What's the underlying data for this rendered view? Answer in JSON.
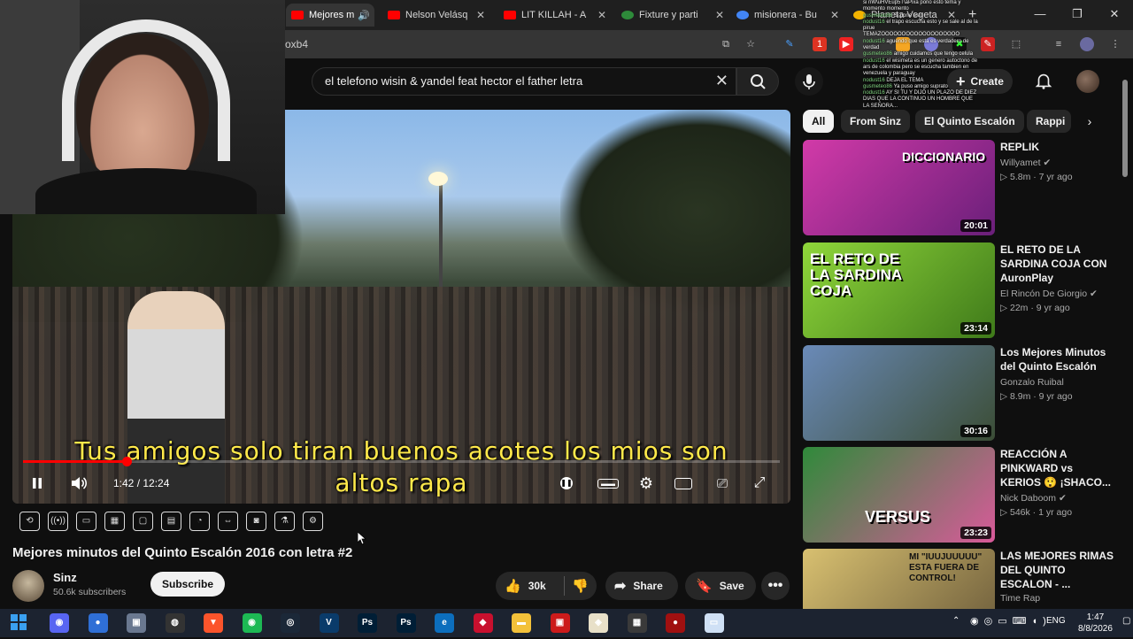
{
  "browser": {
    "tabs": [
      {
        "label": "Mejores m",
        "favicon_color": "#ff0000",
        "active": true
      },
      {
        "label": "Nelson Velásq",
        "favicon_color": "#ff0000",
        "active": false
      },
      {
        "label": "LIT KILLAH - A",
        "favicon_color": "#ff0000",
        "active": false
      },
      {
        "label": "Fixture y parti",
        "favicon_color": "#2e8b3a",
        "active": false
      },
      {
        "label": "misionera - Bu",
        "favicon_color": "#4285f4",
        "active": false
      },
      {
        "label": "Planeta Vegeta",
        "favicon_color": "#f4b400",
        "active": false
      }
    ],
    "new_tab": "+",
    "url_fragment": "oxb4",
    "extension_badge": "1"
  },
  "youtube": {
    "search_query": "el telefono wisin & yandel feat hector el father letra",
    "create_label": "Create"
  },
  "chat_overlay": [
    {
      "user": "",
      "msg": "si nW\\uHVEup5T\\aPixa  pono esto tema y"
    },
    {
      "user": "",
      "msg": "momento momento"
    },
    {
      "user": "gusmeteo86",
      "msg": "Si pone esto"
    },
    {
      "user": "nodust16",
      "msg": "el trapo escucha esto y se sale al de la pirue"
    },
    {
      "user": "",
      "msg": "TEMAZOOOOOOOOOOOOOOOOOOO"
    },
    {
      "user": "nodust16",
      "msg": "aguendo que esta es verdadero de verdad"
    },
    {
      "user": "gusmeteo86",
      "msg": "amigo cuidamos que tengo celula"
    },
    {
      "user": "nodust16",
      "msg": "el wisimeta es un genero autoctono de ars de colombia pero se escucha tambien en venezuela y paraguay"
    },
    {
      "user": "nodust16",
      "msg": "DEJA EL TEMA"
    },
    {
      "user": "gusmeteo86",
      "msg": "Ya puso amigo suprato"
    },
    {
      "user": "nodust16",
      "msg": "AY SI TU Y DIJO UN PLAZO DE DIEZ DIAS QUE LA CONTINUO UN HOMBRE QUE LA SEÑORA..."
    }
  ],
  "player": {
    "subtitle_line1": "Tus amigos solo tiran buenos acotes los mios son",
    "subtitle_line2": "altos rapa",
    "time": "1:42 / 12:24",
    "progress": 0.137
  },
  "video": {
    "title": "Mejores minutos del Quinto Escalón 2016 con letra #2",
    "channel": "Sinz",
    "subscribers": "50.6k subscribers",
    "subscribe_label": "Subscribe",
    "likes": "30k",
    "share_label": "Share",
    "save_label": "Save"
  },
  "chips": [
    "All",
    "From Sinz",
    "El Quinto Escalón",
    "Rappi"
  ],
  "recommendations": [
    {
      "title": "REPLIK",
      "channel": "Willyamet",
      "meta": "5.8m · 7 yr ago",
      "duration": "20:01",
      "thumb_text": "DICCIONARIO",
      "colors": [
        "#d23aa8",
        "#6a1f7a"
      ]
    },
    {
      "title": "EL RETO DE LA SARDINA COJA CON AuronPlay",
      "channel": "El Rincón De Giorgio",
      "meta": "22m · 9 yr ago",
      "duration": "23:14",
      "thumb_text": "EL RETO DE LA SARDINA COJA",
      "colors": [
        "#8fd63a",
        "#3f7a1a"
      ]
    },
    {
      "title": "Los Mejores Minutos del Quinto Escalón",
      "channel": "Gonzalo Ruibal",
      "meta": "8.9m · 9 yr ago",
      "duration": "30:16",
      "thumb_text": "",
      "colors": [
        "#6a8ab8",
        "#3b4d35"
      ]
    },
    {
      "title": "REACCIÓN A PINKWARD vs KERIOS 😲 ¡SHACO...",
      "channel": "Nick Daboom",
      "meta": "546k · 1 yr ago",
      "duration": "23:23",
      "thumb_text": "VERSUS",
      "colors": [
        "#2f8a3a",
        "#d95a9a"
      ]
    },
    {
      "title": "LAS MEJORES RIMAS DEL QUINTO ESCALON - ...",
      "channel": "Time Rap",
      "meta": "",
      "duration": "",
      "thumb_text": "MI \"IUUJUUUUU\" ESTA FUERA DE CONTROL!",
      "colors": [
        "#d8c070",
        "#6a5a3a"
      ]
    }
  ],
  "taskbar": {
    "tray_lang": "ENG",
    "clock_time": "1:47",
    "clock_date": "8/8/2026",
    "apps": [
      {
        "name": "discord-icon",
        "color": "#5865f2",
        "glyph": "◉"
      },
      {
        "name": "chrome-icon",
        "color": "#2f6fd6",
        "glyph": "●"
      },
      {
        "name": "app-icon",
        "color": "#6a7890",
        "glyph": "▣"
      },
      {
        "name": "obs-icon",
        "color": "#333333",
        "glyph": "◍"
      },
      {
        "name": "brave-icon",
        "color": "#fb542b",
        "glyph": "▼"
      },
      {
        "name": "spotify-icon",
        "color": "#1db954",
        "glyph": "◉"
      },
      {
        "name": "steam-icon",
        "color": "#1b2838",
        "glyph": "◎"
      },
      {
        "name": "vegas-icon",
        "color": "#0a3b6a",
        "glyph": "V"
      },
      {
        "name": "photoshop-icon",
        "color": "#001e36",
        "glyph": "Ps"
      },
      {
        "name": "photoshop-icon-2",
        "color": "#001e36",
        "glyph": "Ps"
      },
      {
        "name": "edge-icon",
        "color": "#0c6ebd",
        "glyph": "e"
      },
      {
        "name": "red-app-icon",
        "color": "#c8102e",
        "glyph": "◆"
      },
      {
        "name": "file-explorer-icon",
        "color": "#f3c13a",
        "glyph": "▬"
      },
      {
        "name": "red-box-icon",
        "color": "#cc1b1b",
        "glyph": "▣"
      },
      {
        "name": "cube-icon",
        "color": "#e8e0c8",
        "glyph": "◈"
      },
      {
        "name": "minecraft-icon",
        "color": "#3a3a3a",
        "glyph": "▦"
      },
      {
        "name": "red-circle-icon",
        "color": "#a01010",
        "glyph": "●"
      },
      {
        "name": "window-icon",
        "color": "#cfe0f5",
        "glyph": "▭"
      }
    ]
  }
}
